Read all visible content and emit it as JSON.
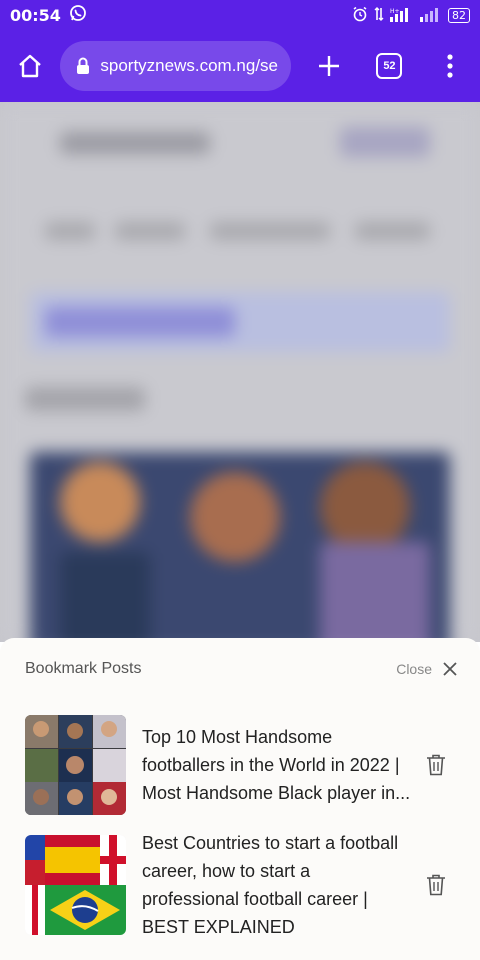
{
  "status_bar": {
    "time": "00:54",
    "battery": "82"
  },
  "browser": {
    "url": "sportyznews.com.ng/se",
    "tab_count": "52"
  },
  "bookmarks_sheet": {
    "title": "Bookmark Posts",
    "close_label": "Close",
    "items": [
      {
        "title": "Top 10 Most Handsome footballers in the World in 2022 | Most Handsome Black player in...",
        "thumbnail": "footballers-collage"
      },
      {
        "title": "Best Countries to start a football career, how to start a professional football career | BEST EXPLAINED",
        "thumbnail": "country-flags-collage"
      }
    ]
  },
  "colors": {
    "toolbar": "#5b21e6",
    "sheet_background": "#fcfbf9"
  }
}
